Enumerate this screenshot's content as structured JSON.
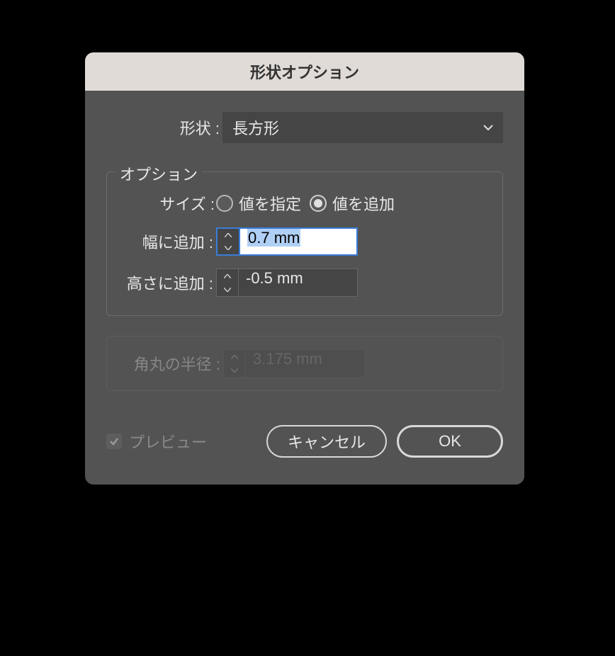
{
  "dialog": {
    "title": "形状オプション",
    "shape": {
      "label": "形状 :",
      "selected": "長方形"
    },
    "options": {
      "title": "オプション",
      "size": {
        "label": "サイズ :",
        "specify": "値を指定",
        "add": "値を追加",
        "selected": "add"
      },
      "width": {
        "label": "幅に追加 :",
        "value": "0.7 mm"
      },
      "height": {
        "label": "高さに追加 :",
        "value": "-0.5 mm"
      }
    },
    "corner": {
      "label": "角丸の半径 :",
      "value": "3.175 mm"
    },
    "footer": {
      "preview": "プレビュー",
      "cancel": "キャンセル",
      "ok": "OK"
    }
  }
}
